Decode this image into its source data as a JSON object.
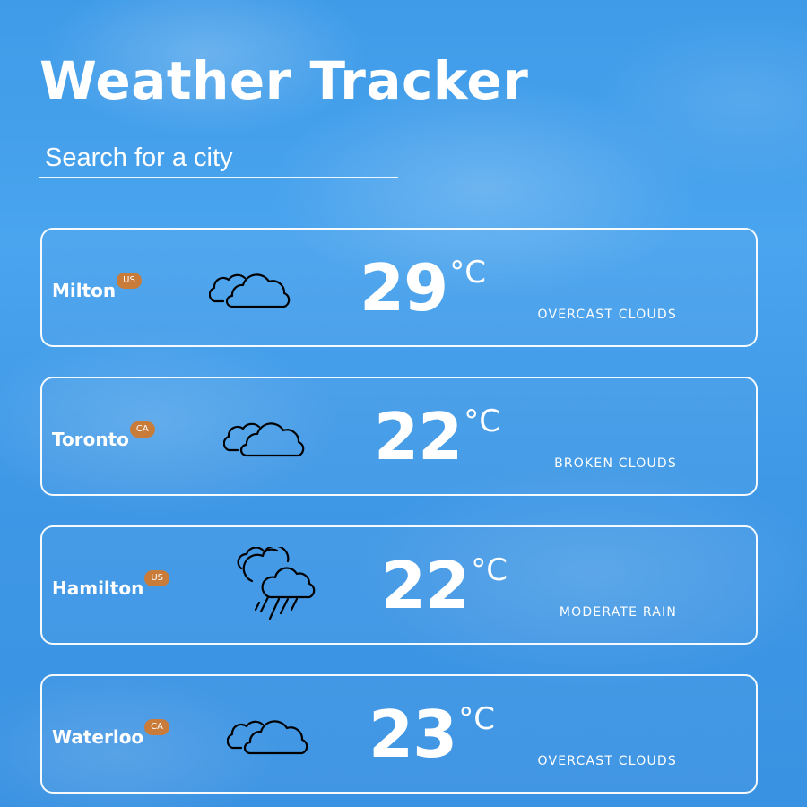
{
  "header": {
    "title": "Weather Tracker"
  },
  "search": {
    "placeholder": "Search for a city",
    "value": ""
  },
  "cities": [
    {
      "name": "Milton",
      "country": "US",
      "temperature": "29",
      "unit": "°C",
      "condition": "OVERCAST CLOUDS",
      "icon": "cloudy-icon"
    },
    {
      "name": "Toronto",
      "country": "CA",
      "temperature": "22",
      "unit": "°C",
      "condition": "BROKEN CLOUDS",
      "icon": "cloudy-icon"
    },
    {
      "name": "Hamilton",
      "country": "US",
      "temperature": "22",
      "unit": "°C",
      "condition": "MODERATE RAIN",
      "icon": "rain-icon"
    },
    {
      "name": "Waterloo",
      "country": "CA",
      "temperature": "23",
      "unit": "°C",
      "condition": "OVERCAST CLOUDS",
      "icon": "cloudy-icon"
    }
  ],
  "colors": {
    "background": "#3f9be8",
    "badge": "#c97b3a",
    "text": "#ffffff",
    "card_border": "#ffffff"
  }
}
